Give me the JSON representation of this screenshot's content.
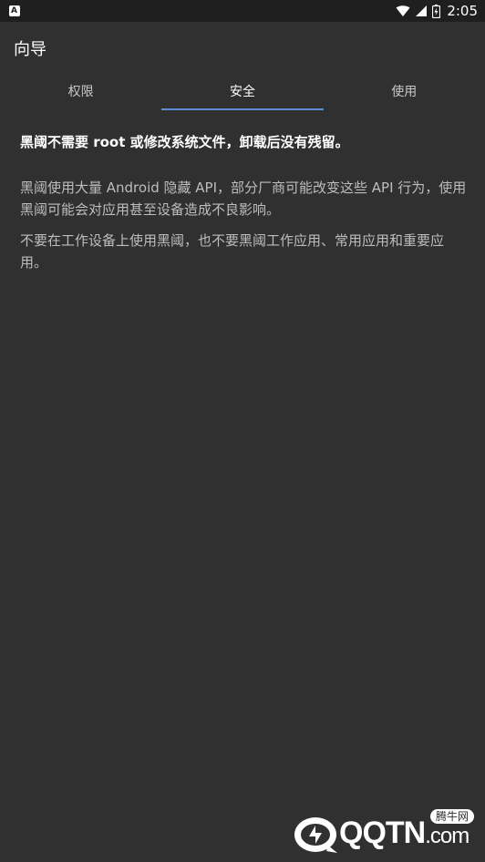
{
  "status_bar": {
    "time": "2:05",
    "notification_icon": "app-notification-icon",
    "icons": [
      "wifi-icon",
      "signal-icon",
      "battery-icon"
    ]
  },
  "app_bar": {
    "title": "向导"
  },
  "tabs": [
    {
      "label": "权限",
      "active": false
    },
    {
      "label": "安全",
      "active": true
    },
    {
      "label": "使用",
      "active": false
    }
  ],
  "colors": {
    "background": "#303030",
    "status_bar": "#1f1f1f",
    "accent": "#5b8ed6",
    "primary_text": "#ffffff",
    "secondary_text": "#bdbdbd"
  },
  "content": {
    "heading": "黑阈不需要 root 或修改系统文件，卸载后没有残留。",
    "paragraphs": [
      "黑阈使用大量 Android 隐藏 API，部分厂商可能改变这些 API 行为，使用黑阈可能会对应用甚至设备造成不良影响。",
      "不要在工作设备上使用黑阈，也不要黑阈工作应用、常用应用和重要应用。"
    ]
  },
  "watermark": {
    "brand": "QQTN",
    "domain_suffix": ".com",
    "tag": "腾牛网"
  }
}
